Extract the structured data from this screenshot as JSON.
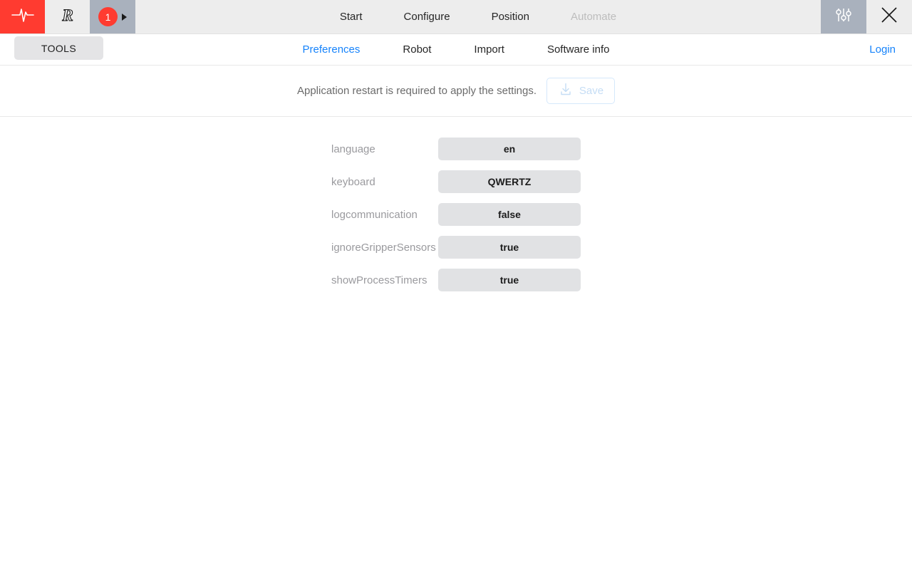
{
  "topbar": {
    "alert_icon": "heartbeat-icon",
    "logo_icon": "r-logo-icon",
    "badge_count": "1",
    "badge_caret_icon": "caret-right-icon",
    "nav": [
      {
        "label": "Start",
        "disabled": false
      },
      {
        "label": "Configure",
        "disabled": false
      },
      {
        "label": "Position",
        "disabled": false
      },
      {
        "label": "Automate",
        "disabled": true
      }
    ],
    "sliders_icon": "sliders-icon",
    "close_icon": "close-icon"
  },
  "subbar": {
    "tools_label": "TOOLS",
    "tabs": [
      {
        "label": "Preferences",
        "active": true
      },
      {
        "label": "Robot",
        "active": false
      },
      {
        "label": "Import",
        "active": false
      },
      {
        "label": "Software info",
        "active": false
      }
    ],
    "login_label": "Login"
  },
  "savebar": {
    "message": "Application restart is required to apply the settings.",
    "save_label": "Save",
    "save_icon": "download-save-icon"
  },
  "settings": [
    {
      "key": "language",
      "value": "en"
    },
    {
      "key": "keyboard",
      "value": "QWERTZ"
    },
    {
      "key": "logcommunication",
      "value": "false"
    },
    {
      "key": "ignoreGripperSensors",
      "value": "true"
    },
    {
      "key": "showProcessTimers",
      "value": "true"
    }
  ],
  "colors": {
    "accent_blue": "#1683fb",
    "alert_red": "#ff3b30",
    "panel_gray_blue": "#a9b1bd",
    "topbar_gray": "#ededed",
    "value_field": "#e1e2e4"
  }
}
